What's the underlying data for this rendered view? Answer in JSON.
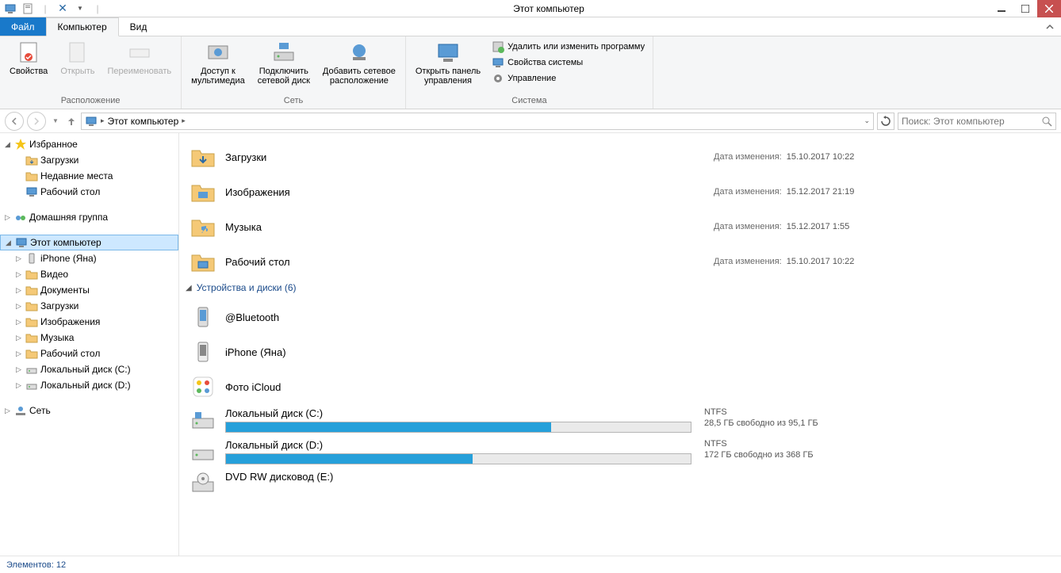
{
  "window": {
    "title": "Этот компьютер"
  },
  "tabs": {
    "file": "Файл",
    "computer": "Компьютер",
    "view": "Вид"
  },
  "ribbon": {
    "location": {
      "label": "Расположение",
      "props": "Свойства",
      "open": "Открыть",
      "rename": "Переименовать"
    },
    "network": {
      "label": "Сеть",
      "media": "Доступ к\nмультимедиа",
      "mapdrive": "Подключить\nсетевой диск",
      "addnet": "Добавить сетевое\nрасположение"
    },
    "system": {
      "label": "Система",
      "cpanel": "Открыть панель\nуправления",
      "uninstall": "Удалить или изменить программу",
      "sysprops": "Свойства системы",
      "manage": "Управление"
    }
  },
  "breadcrumb": {
    "root": "Этот компьютер"
  },
  "search": {
    "placeholder": "Поиск: Этот компьютер"
  },
  "tree": {
    "favorites": "Избранное",
    "downloads": "Загрузки",
    "recent": "Недавние места",
    "desktop": "Рабочий стол",
    "homegroup": "Домашняя группа",
    "thispc": "Этот компьютер",
    "iphone": "iPhone (Яна)",
    "videos": "Видео",
    "documents": "Документы",
    "downloads2": "Загрузки",
    "pictures": "Изображения",
    "music": "Музыка",
    "desktop2": "Рабочий стол",
    "diskC": "Локальный диск (C:)",
    "diskD": "Локальный диск (D:)",
    "network": "Сеть"
  },
  "folders": [
    {
      "name": "Загрузки",
      "meta_label": "Дата изменения:",
      "meta_value": "15.10.2017 10:22"
    },
    {
      "name": "Изображения",
      "meta_label": "Дата изменения:",
      "meta_value": "15.12.2017 21:19"
    },
    {
      "name": "Музыка",
      "meta_label": "Дата изменения:",
      "meta_value": "15.12.2017 1:55"
    },
    {
      "name": "Рабочий стол",
      "meta_label": "Дата изменения:",
      "meta_value": "15.10.2017 10:22"
    }
  ],
  "devices_header": "Устройства и диски (6)",
  "devices": [
    {
      "name": "@Bluetooth"
    },
    {
      "name": "iPhone (Яна)"
    },
    {
      "name": "Фото iCloud"
    }
  ],
  "drives": [
    {
      "name": "Локальный диск (C:)",
      "fs": "NTFS",
      "free": "28,5 ГБ свободно из 95,1 ГБ",
      "pct": 70
    },
    {
      "name": "Локальный диск (D:)",
      "fs": "NTFS",
      "free": "172 ГБ свободно из 368 ГБ",
      "pct": 53
    },
    {
      "name": "DVD RW дисковод (E:)"
    }
  ],
  "status": "Элементов: 12"
}
